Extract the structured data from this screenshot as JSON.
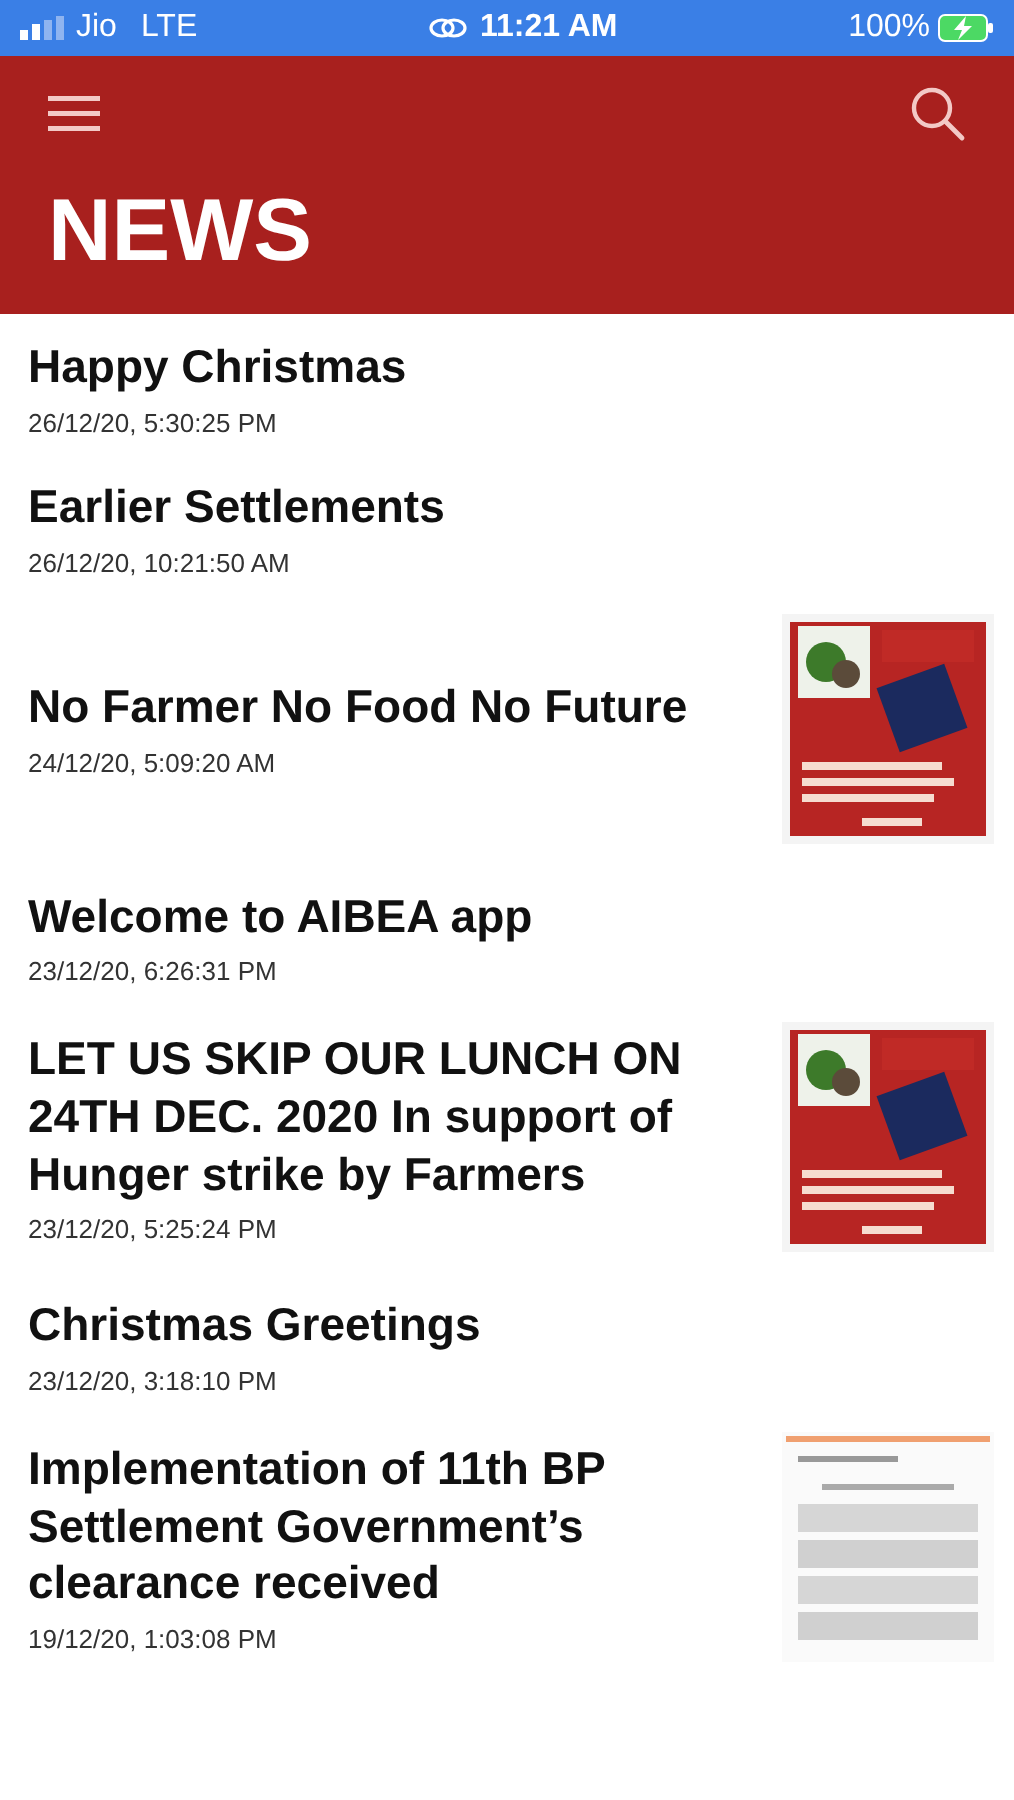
{
  "status_bar": {
    "carrier": "Jio",
    "network": "LTE",
    "time": "11:21 AM",
    "battery": "100%"
  },
  "header": {
    "title": "NEWS"
  },
  "news": [
    {
      "title": "Happy Christmas",
      "date": "26/12/20, 5:30:25 PM"
    },
    {
      "title": "Earlier Settlements",
      "date": "26/12/20, 10:21:50 AM"
    },
    {
      "title": "No Farmer No Food No Future",
      "date": "24/12/20, 5:09:20 AM",
      "thumbnail": {
        "kind": "poster"
      }
    },
    {
      "title": "Welcome to AIBEA app",
      "date": "23/12/20, 6:26:31 PM"
    },
    {
      "title": "LET US SKIP OUR LUNCH ON 24TH DEC. 2020 In support of Hunger strike by Farmers",
      "date": "23/12/20, 5:25:24 PM",
      "thumbnail": {
        "kind": "poster"
      }
    },
    {
      "title": "Christmas Greetings",
      "date": "23/12/20, 3:18:10 PM"
    },
    {
      "title": "Implementation of 11th BP Settlement Government’s clearance received",
      "date": "19/12/20, 1:03:08 PM",
      "thumbnail": {
        "kind": "document"
      }
    }
  ]
}
